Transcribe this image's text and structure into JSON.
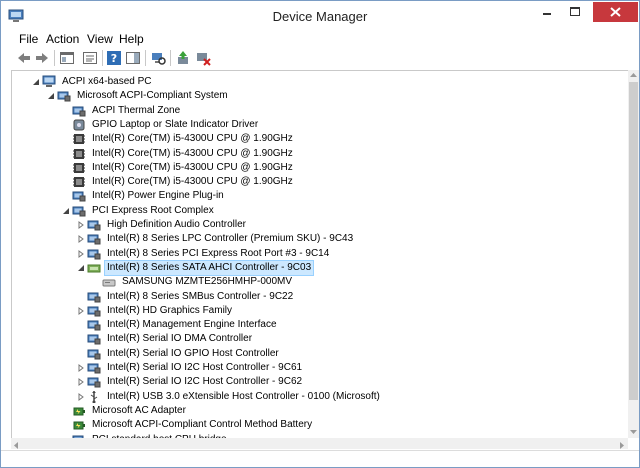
{
  "window": {
    "title": "Device Manager"
  },
  "menu": [
    "File",
    "Action",
    "View",
    "Help"
  ],
  "tree": [
    {
      "label": "ACPI x64-based PC",
      "indent": 0,
      "expander": "open",
      "icon": "computer-icon"
    },
    {
      "label": "Microsoft ACPI-Compliant System",
      "indent": 1,
      "expander": "open",
      "icon": "system-icon"
    },
    {
      "label": "ACPI Thermal Zone",
      "indent": 2,
      "expander": "none",
      "icon": "system-icon"
    },
    {
      "label": "GPIO Laptop or Slate Indicator Driver",
      "indent": 2,
      "expander": "none",
      "icon": "hid-icon"
    },
    {
      "label": "Intel(R) Core(TM) i5-4300U CPU @ 1.90GHz",
      "indent": 2,
      "expander": "none",
      "icon": "cpu-icon"
    },
    {
      "label": "Intel(R) Core(TM) i5-4300U CPU @ 1.90GHz",
      "indent": 2,
      "expander": "none",
      "icon": "cpu-icon"
    },
    {
      "label": "Intel(R) Core(TM) i5-4300U CPU @ 1.90GHz",
      "indent": 2,
      "expander": "none",
      "icon": "cpu-icon"
    },
    {
      "label": "Intel(R) Core(TM) i5-4300U CPU @ 1.90GHz",
      "indent": 2,
      "expander": "none",
      "icon": "cpu-icon"
    },
    {
      "label": "Intel(R) Power Engine Plug-in",
      "indent": 2,
      "expander": "none",
      "icon": "system-icon"
    },
    {
      "label": "PCI Express Root Complex",
      "indent": 2,
      "expander": "open",
      "icon": "system-icon"
    },
    {
      "label": "High Definition Audio Controller",
      "indent": 3,
      "expander": "closed",
      "icon": "system-icon"
    },
    {
      "label": "Intel(R) 8 Series LPC Controller (Premium SKU) - 9C43",
      "indent": 3,
      "expander": "closed",
      "icon": "system-icon"
    },
    {
      "label": "Intel(R) 8 Series PCI Express Root Port #3 - 9C14",
      "indent": 3,
      "expander": "closed",
      "icon": "system-icon"
    },
    {
      "label": "Intel(R) 8 Series SATA AHCI Controller - 9C03",
      "indent": 3,
      "expander": "open",
      "icon": "storage-controller-icon",
      "selected": true
    },
    {
      "label": "SAMSUNG MZMTE256HMHP-000MV",
      "indent": 4,
      "expander": "none",
      "icon": "disk-drive-icon"
    },
    {
      "label": "Intel(R) 8 Series SMBus Controller - 9C22",
      "indent": 3,
      "expander": "none",
      "icon": "system-icon"
    },
    {
      "label": "Intel(R) HD Graphics Family",
      "indent": 3,
      "expander": "closed",
      "icon": "system-icon"
    },
    {
      "label": "Intel(R) Management Engine Interface",
      "indent": 3,
      "expander": "none",
      "icon": "system-icon"
    },
    {
      "label": "Intel(R) Serial IO DMA Controller",
      "indent": 3,
      "expander": "none",
      "icon": "system-icon"
    },
    {
      "label": "Intel(R) Serial IO GPIO Host Controller",
      "indent": 3,
      "expander": "none",
      "icon": "system-icon"
    },
    {
      "label": "Intel(R) Serial IO I2C Host Controller - 9C61",
      "indent": 3,
      "expander": "closed",
      "icon": "system-icon"
    },
    {
      "label": "Intel(R) Serial IO I2C Host Controller - 9C62",
      "indent": 3,
      "expander": "closed",
      "icon": "system-icon"
    },
    {
      "label": "Intel(R) USB 3.0 eXtensible Host Controller - 0100 (Microsoft)",
      "indent": 3,
      "expander": "closed",
      "icon": "usb-icon"
    },
    {
      "label": "Microsoft AC Adapter",
      "indent": 2,
      "expander": "none",
      "icon": "battery-icon"
    },
    {
      "label": "Microsoft ACPI-Compliant Control Method Battery",
      "indent": 2,
      "expander": "none",
      "icon": "battery-icon"
    },
    {
      "label": "PCI standard host CPU bridge",
      "indent": 2,
      "expander": "none",
      "icon": "system-icon"
    }
  ],
  "toolbar": [
    "back-arrow-icon",
    "forward-arrow-icon",
    "properties-pane-icon",
    "console-tree-icon",
    "help-icon",
    "show-hide-icon",
    "scan-hardware-icon",
    "update-driver-icon",
    "uninstall-device-icon"
  ],
  "colors": {
    "selection": "#cce8ff",
    "close_button": "#c7383d"
  }
}
